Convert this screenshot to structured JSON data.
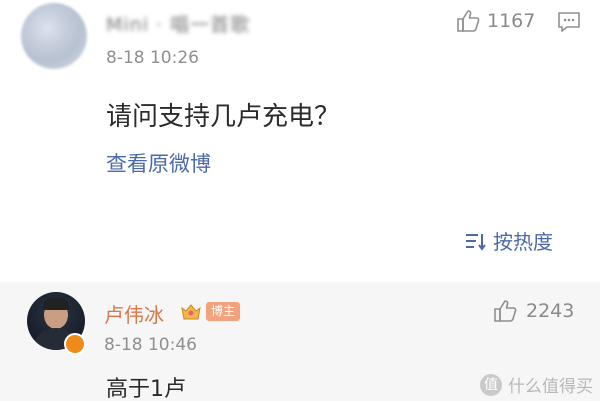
{
  "comment": {
    "user_name": "Mini · 唱一首歌",
    "time": "8-18 10:26",
    "like_count": "1167",
    "text": "请问支持几卢充电？",
    "view_original": "查看原微博"
  },
  "sort": {
    "label": "按热度"
  },
  "reply": {
    "user_name": "卢伟冰",
    "badge": "博主",
    "time": "8-18 10:46",
    "like_count": "2243",
    "text": "高于1卢"
  },
  "watermark": {
    "icon": "值",
    "text": "什么值得买"
  }
}
